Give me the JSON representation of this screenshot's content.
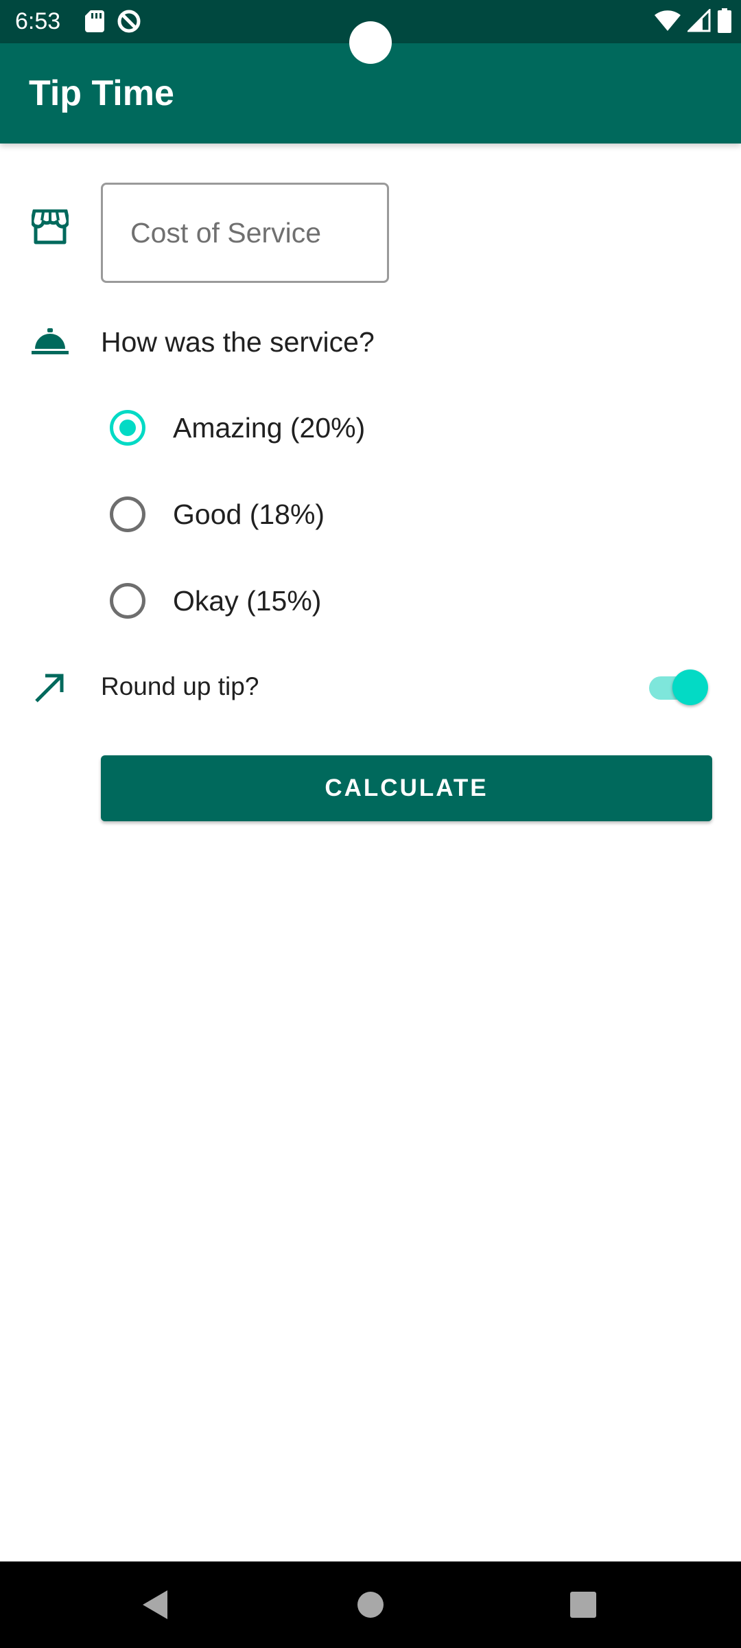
{
  "status_bar": {
    "time": "6:53",
    "icons_left": [
      "sd-card-icon",
      "data-saver-icon"
    ],
    "icons_right": [
      "wifi-icon",
      "cellular-signal-icon",
      "battery-icon"
    ]
  },
  "app_bar": {
    "title": "Tip Time"
  },
  "cost_field": {
    "placeholder": "Cost of Service",
    "value": ""
  },
  "service": {
    "question": "How was the service?",
    "options": [
      {
        "label": "Amazing (20%)",
        "checked": true
      },
      {
        "label": "Good (18%)",
        "checked": false
      },
      {
        "label": "Okay (15%)",
        "checked": false
      }
    ]
  },
  "round_up": {
    "label": "Round up tip?",
    "on": true
  },
  "calculate_button": {
    "label": "CALCULATE"
  },
  "colors": {
    "primary": "#00695C",
    "status_bar": "#00483F",
    "accent": "#03DAC5",
    "switch_track": "#7EE6DB"
  },
  "nav_bar": {
    "buttons": [
      "back-icon",
      "home-icon",
      "recents-icon"
    ]
  }
}
